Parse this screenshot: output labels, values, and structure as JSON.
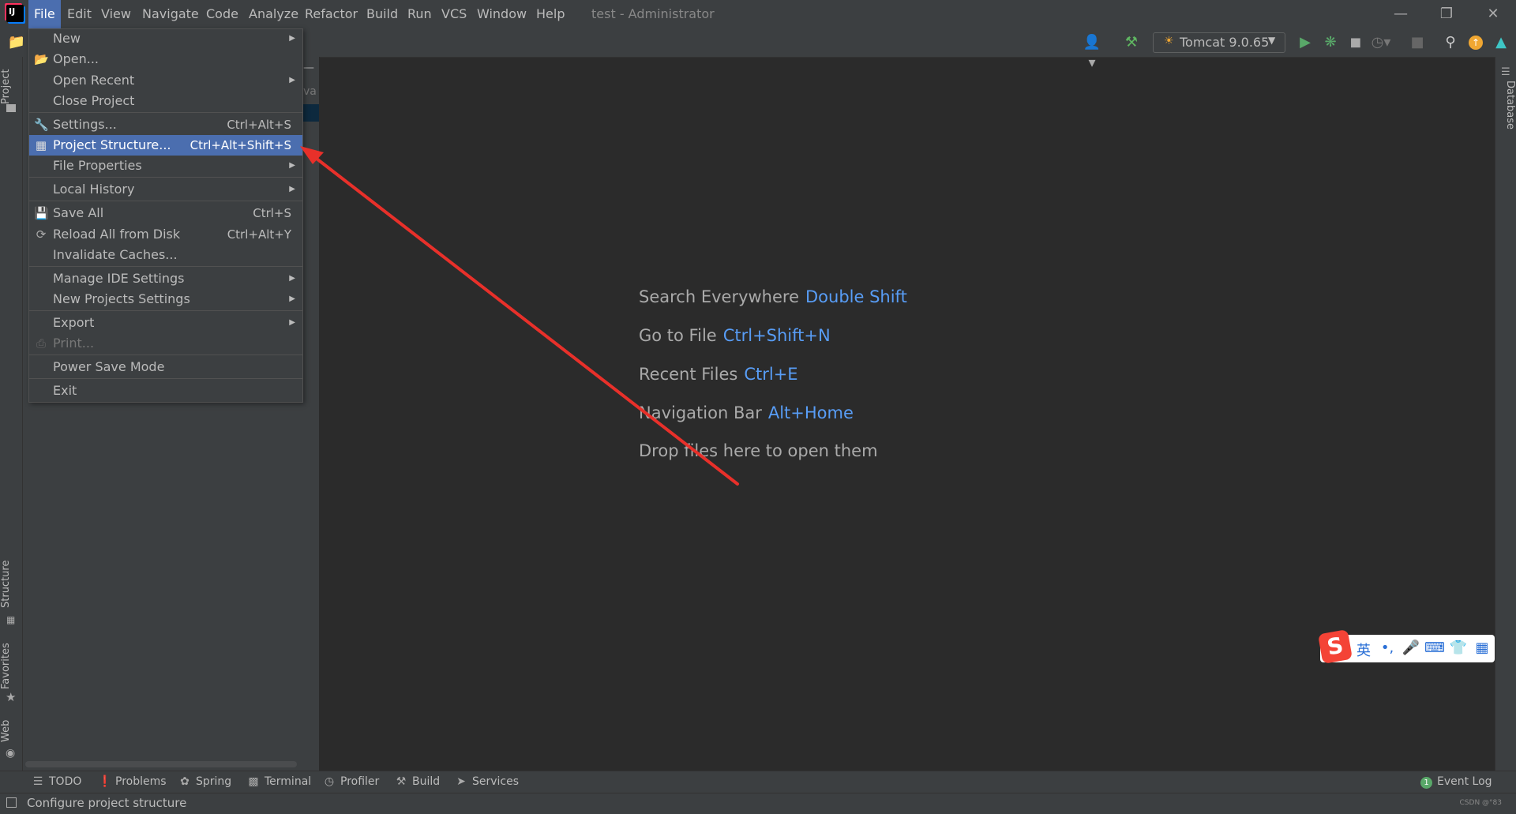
{
  "window": {
    "title": "test - Administrator"
  },
  "menubar": [
    "File",
    "Edit",
    "View",
    "Navigate",
    "Code",
    "Analyze",
    "Refactor",
    "Build",
    "Run",
    "VCS",
    "Window",
    "Help"
  ],
  "toolbar": {
    "run_config": "Tomcat 9.0.65"
  },
  "side_tabs": {
    "project": "Project",
    "structure": "Structure",
    "favorites": "Favorites",
    "web": "Web",
    "database": "Database"
  },
  "file_menu": {
    "items": [
      {
        "label": "New",
        "shortcut": "",
        "submenu": true
      },
      {
        "label": "Open...",
        "shortcut": "",
        "submenu": false,
        "icon": "folder-icon"
      },
      {
        "label": "Open Recent",
        "shortcut": "",
        "submenu": true
      },
      {
        "label": "Close Project",
        "shortcut": "",
        "submenu": false
      },
      {
        "label": "Settings...",
        "shortcut": "Ctrl+Alt+S",
        "submenu": false,
        "icon": "wrench-icon"
      },
      {
        "label": "Project Structure...",
        "shortcut": "Ctrl+Alt+Shift+S",
        "submenu": false,
        "icon": "project-structure-icon",
        "highlighted": true
      },
      {
        "label": "File Properties",
        "shortcut": "",
        "submenu": true
      },
      {
        "label": "Local History",
        "shortcut": "",
        "submenu": true
      },
      {
        "label": "Save All",
        "shortcut": "Ctrl+S",
        "submenu": false,
        "icon": "save-icon"
      },
      {
        "label": "Reload All from Disk",
        "shortcut": "Ctrl+Alt+Y",
        "submenu": false,
        "icon": "reload-icon"
      },
      {
        "label": "Invalidate Caches...",
        "shortcut": "",
        "submenu": false
      },
      {
        "label": "Manage IDE Settings",
        "shortcut": "",
        "submenu": true
      },
      {
        "label": "New Projects Settings",
        "shortcut": "",
        "submenu": true
      },
      {
        "label": "Export",
        "shortcut": "",
        "submenu": true
      },
      {
        "label": "Print...",
        "shortcut": "",
        "submenu": false,
        "icon": "print-icon",
        "disabled": true
      },
      {
        "label": "Power Save Mode",
        "shortcut": "",
        "submenu": false
      },
      {
        "label": "Exit",
        "shortcut": "",
        "submenu": false
      }
    ]
  },
  "editor_hints": [
    {
      "text": "Search Everywhere",
      "key": "Double Shift"
    },
    {
      "text": "Go to File",
      "key": "Ctrl+Shift+N"
    },
    {
      "text": "Recent Files",
      "key": "Ctrl+E"
    },
    {
      "text": "Navigation Bar",
      "key": "Alt+Home"
    },
    {
      "text": "Drop files here to open them",
      "key": ""
    }
  ],
  "bottom_tabs": [
    "TODO",
    "Problems",
    "Spring",
    "Terminal",
    "Profiler",
    "Build",
    "Services"
  ],
  "event_log": {
    "label": "Event Log",
    "count": "1"
  },
  "status": {
    "text": "Configure project structure",
    "watermark": "CSDN @°83"
  },
  "ime": {
    "lang": "英",
    "punct": "•,"
  },
  "panel_fragment": "va",
  "colors": {
    "accent": "#4b6eaf",
    "link": "#589df6",
    "annotation_arrow": "#e8302a"
  }
}
